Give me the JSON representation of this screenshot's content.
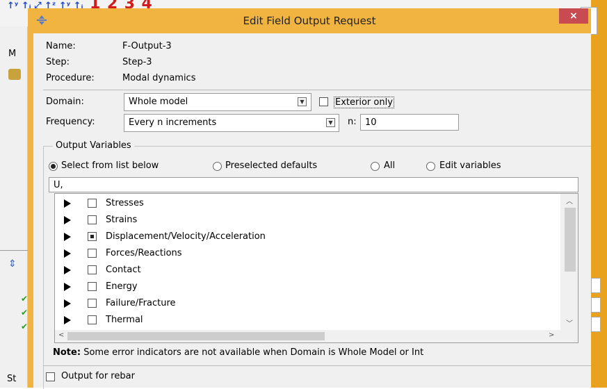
{
  "dialog": {
    "title": "Edit Field Output Request",
    "close_glyph": "×"
  },
  "request": {
    "name_label": "Name:",
    "name_value": "F-Output-3",
    "step_label": "Step:",
    "step_value": "Step-3",
    "procedure_label": "Procedure:",
    "procedure_value": "Modal dynamics"
  },
  "domain": {
    "label": "Domain:",
    "value": "Whole model",
    "exterior_label": "Exterior only",
    "exterior_checked": false
  },
  "frequency": {
    "label": "Frequency:",
    "value": "Every n increments",
    "n_label": "n:",
    "n_value": "10"
  },
  "output_variables": {
    "group_title": "Output Variables",
    "radios": [
      {
        "label": "Select from list below",
        "selected": true
      },
      {
        "label": "Preselected defaults",
        "selected": false
      },
      {
        "label": "All",
        "selected": false
      },
      {
        "label": "Edit variables",
        "selected": false
      }
    ],
    "filter_text": "U,",
    "items": [
      {
        "label": "Stresses",
        "state": "unchecked"
      },
      {
        "label": "Strains",
        "state": "unchecked"
      },
      {
        "label": "Displacement/Velocity/Acceleration",
        "state": "partial"
      },
      {
        "label": "Forces/Reactions",
        "state": "unchecked"
      },
      {
        "label": "Contact",
        "state": "unchecked"
      },
      {
        "label": "Energy",
        "state": "unchecked"
      },
      {
        "label": "Failure/Fracture",
        "state": "unchecked"
      },
      {
        "label": "Thermal",
        "state": "unchecked"
      }
    ]
  },
  "note": {
    "prefix": "Note:",
    "text": "Some error indicators are not available when Domain is Whole Model or Int"
  },
  "rebar": {
    "label": "Output for rebar",
    "checked": false
  },
  "background": {
    "left_label_m": "M",
    "left_label_st": "St",
    "toolbar_numbers": [
      "1",
      "2",
      "3",
      "4"
    ]
  },
  "colors": {
    "title_bar": "#f2b440",
    "close_button": "#c74b50",
    "client": "#f0f0f0"
  }
}
